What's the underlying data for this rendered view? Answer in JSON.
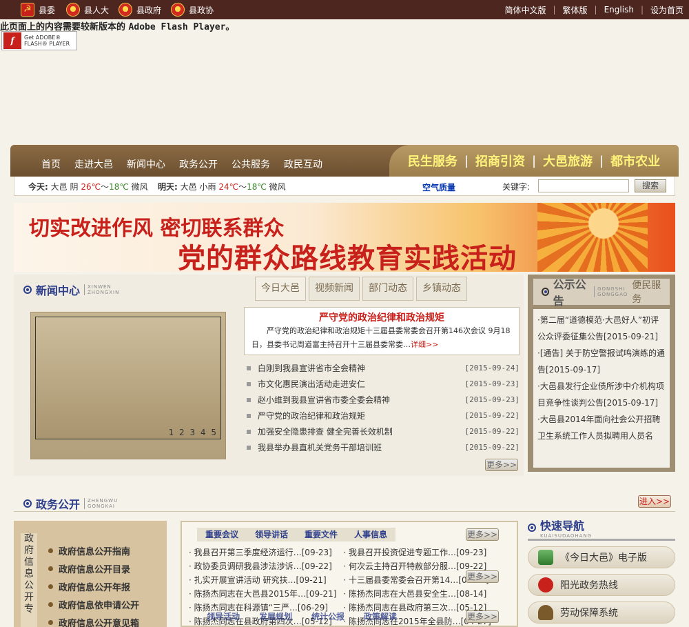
{
  "topbar": {
    "orgs": [
      "县委",
      "县人大",
      "县政府",
      "县政协"
    ],
    "links": [
      "简体中文版",
      "繁体版",
      "English",
      "设为首页"
    ]
  },
  "flash": {
    "message": "此页面上的内容需要较新版本的",
    "product": "Adobe Flash Player。",
    "button_line1": "Get ADOBE®",
    "button_line2": "FLASH® PLAYER"
  },
  "nav": {
    "items": [
      "首页",
      "走进大邑",
      "政务公开",
      "新闻中心",
      "公共服务",
      "政民互动"
    ],
    "promo": [
      "民生服务",
      "招商引资",
      "大邑旅游",
      "都市农业"
    ]
  },
  "weather": {
    "today_label": "今天:",
    "today_city": "大邑",
    "today_cond": "阴",
    "today_high": "26℃",
    "today_sep": "～",
    "today_low": "18℃",
    "today_wind": "微风",
    "tomorrow_label": "明天:",
    "tomorrow_city": "大邑",
    "tomorrow_cond": "小雨",
    "tomorrow_high": "24℃",
    "tomorrow_sep": "～",
    "tomorrow_low": "18℃",
    "tomorrow_wind": "微风",
    "air_quality": "空气质量",
    "search_label": "关键字:",
    "search_value": "",
    "search_button": "搜索"
  },
  "banner": {
    "line1": "切实改进作风  密切联系群众",
    "line2": "党的群众路线教育实践活动"
  },
  "news": {
    "title": "新闻中心",
    "pinyin1": "XINWEN",
    "pinyin2": "ZHONGXIN",
    "tabs": [
      "今日大邑",
      "视频新闻",
      "部门动态",
      "乡镇动态"
    ],
    "slide_numbers": "1 2 3 4 5",
    "headline": "严守党的政治纪律和政治规矩",
    "summary": "严守党的政治纪律和政治规矩十三届县委常委会召开第146次会议  9月18日，县委书记周道富主持召开十三届县委常委…",
    "summary_more": "详细>>",
    "items": [
      {
        "title": "白刚到我县宣讲省市全会精神",
        "date": "[2015-09-24]"
      },
      {
        "title": "市文化惠民演出活动走进安仁",
        "date": "[2015-09-23]"
      },
      {
        "title": "赵小维到我县宣讲省市委全委会精神",
        "date": "[2015-09-23]"
      },
      {
        "title": "严守党的政治纪律和政治规矩",
        "date": "[2015-09-22]"
      },
      {
        "title": "加强安全隐患排查  健全完善长效机制",
        "date": "[2015-09-22]"
      },
      {
        "title": "我县举办县直机关党务干部培训班",
        "date": "[2015-09-22]"
      }
    ],
    "more": "更多>>"
  },
  "announce": {
    "title": "公示公告",
    "pinyin1": "GONGSHI",
    "pinyin2": "GONGGAO",
    "alt_tab": "便民服务",
    "items": [
      "·第二届“道德模范·大邑好人”初评公众评委征集公告[2015-09-21]",
      "·[通告] 关于防空警报试鸣演练的通告[2015-09-17]",
      "·大邑县发行企业债所涉中介机构项目竞争性谈判公告[2015-09-17]",
      "·大邑县2014年面向社会公开招聘卫生系统工作人员拟聘用人员名"
    ]
  },
  "gov": {
    "title": "政务公开",
    "pinyin1": "ZHENGWU",
    "pinyin2": "GONGKAI",
    "enter": "进入>>",
    "vertical": "政府信息公开专",
    "side_items": [
      "政府信息公开指南",
      "政府信息公开目录",
      "政府信息公开年报",
      "政府信息依申请公开",
      "政府信息公开意见箱"
    ],
    "tabs": [
      "重要会议",
      "领导讲话",
      "重要文件",
      "人事信息"
    ],
    "tabs2": [
      "领导活动",
      "发展规划",
      "统计公报",
      "政策解读"
    ],
    "more": "更多>>",
    "col1": [
      "· 我县召开第三季度经济运行…[09-23]",
      "· 政协委员调研我县涉法涉诉…[09-22]",
      "· 扎实开展宣讲活动  研究扶…[09-21]",
      "· 陈扬杰同志在大邑县2015年…[09-21]",
      "· 陈扬杰同志在科源镇“三严…[06-29]",
      "· 陈扬杰同志在县政府第四次…[05-12]"
    ],
    "col2": [
      "· 我县召开投资促进专题工作…[09-23]",
      "· 何次云主持召开特赦部分服…[09-22]",
      "· 十三届县委常委会召开第14…[09-21]",
      "· 陈扬杰同志在大邑县安全生…[08-14]",
      "· 陈扬杰同志在县政府第三次…[05-12]",
      "· 陈扬杰同志在2015年全县防…[04-27]"
    ]
  },
  "quick": {
    "title": "快速导航",
    "pinyin": "KUAISUDAOHANG",
    "items": [
      "《今日大邑》电子版",
      "阳光政务热线",
      "劳动保障系统"
    ]
  }
}
